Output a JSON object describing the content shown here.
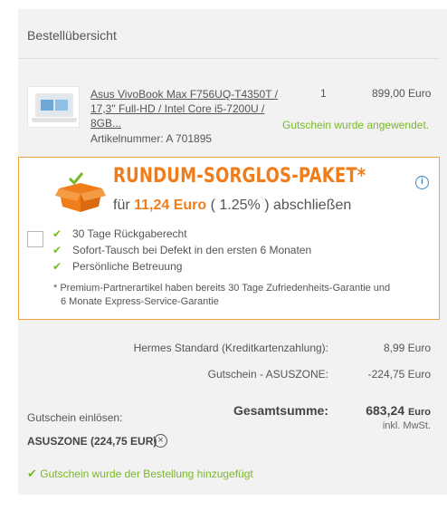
{
  "order_overview": {
    "title": "Bestellübersicht"
  },
  "product": {
    "name_line1": "Asus VivoBook Max F756UQ-T4350T /",
    "name_line2": "17,3\" Full-HD / Intel Core i5-7200U / 8GB...",
    "quantity": "1",
    "price": "899,00 Euro",
    "coupon_applied": "Gutschein wurde angewendet.",
    "article_number": "Artikelnummer: A 701895",
    "image_icon": "laptop-image"
  },
  "protection": {
    "title": "RUNDUM-SORGLOS-PAKET*",
    "prefix": "für",
    "amount": "11,24 Euro",
    "percent": "( 1.25% )",
    "suffix": "abschließen",
    "benefits": [
      "30 Tage Rückgaberecht",
      "Sofort-Tausch bei Defekt in den ersten 6 Monaten",
      "Persönliche Betreuung"
    ],
    "note_line1": "* Premium-Partnerartikel haben bereits 30 Tage Zufriedenheits-Garantie und",
    "note_line2": "6 Monate Express-Service-Garantie",
    "icon": "package-icon",
    "info_icon": "info-icon"
  },
  "summary": {
    "shipping_label": "Hermes Standard (Kreditkartenzahlung):",
    "shipping_value": "8,99 Euro",
    "voucher_label": "Gutschein - ASUSZONE:",
    "voucher_value": "-224,75 Euro",
    "total_label": "Gesamtsumme:",
    "total_value": "683,24",
    "total_currency": "Euro",
    "tax_note": "inkl. MwSt."
  },
  "coupon": {
    "label": "Gutschein einlösen:",
    "code": "ASUSZONE (224,75 EUR)",
    "success": "Gutschein wurde der Bestellung hinzugefügt"
  },
  "colors": {
    "accent_orange": "#f07d1a",
    "success_green": "#79b82a",
    "info_blue": "#3a86c8"
  }
}
